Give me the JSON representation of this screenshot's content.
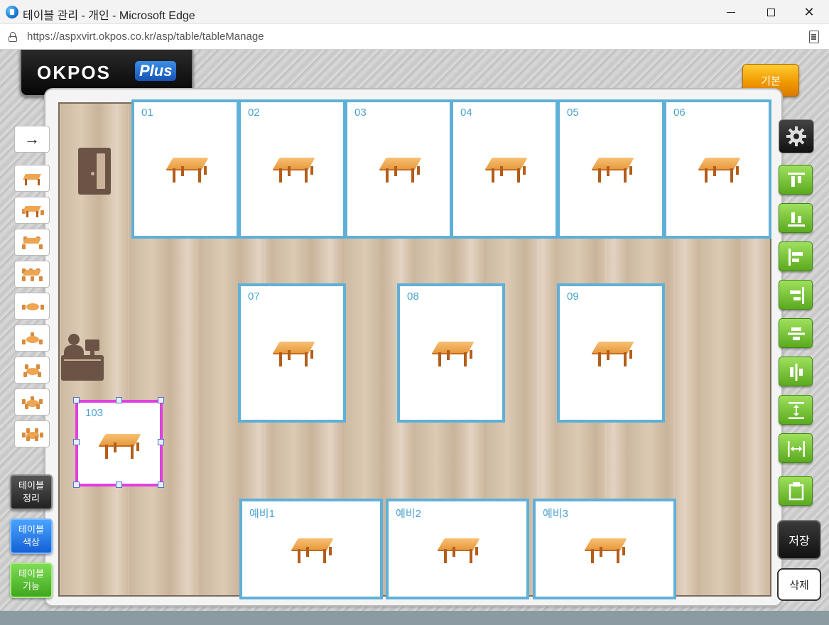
{
  "window": {
    "title": "테이블 관리 - 개인 - Microsoft Edge",
    "url": "https://aspxvirt.okpos.co.kr/asp/table/tableManage"
  },
  "logo": {
    "text": "OKPOS",
    "badge": "Plus"
  },
  "header": {
    "basic_label": "기본"
  },
  "tables": [
    {
      "no": "01"
    },
    {
      "no": "02"
    },
    {
      "no": "03"
    },
    {
      "no": "04"
    },
    {
      "no": "05"
    },
    {
      "no": "06"
    },
    {
      "no": "07"
    },
    {
      "no": "08"
    },
    {
      "no": "09"
    },
    {
      "no": "103",
      "selected": true
    },
    {
      "no": "예비1"
    },
    {
      "no": "예비2"
    },
    {
      "no": "예비3"
    }
  ],
  "left_toolbar": {
    "arrow": "→",
    "buttons": [
      {
        "label": "테이블\n정리"
      },
      {
        "label": "테이블\n색상"
      },
      {
        "label": "테이블\n기능"
      }
    ]
  },
  "right_toolbar": {
    "save_label": "저장",
    "delete_label": "삭제"
  },
  "colors": {
    "table_border": "#5fb0d8",
    "selected_border": "#e040e0",
    "basic_button": "#f09a00",
    "align_button": "#5aaa1e"
  }
}
